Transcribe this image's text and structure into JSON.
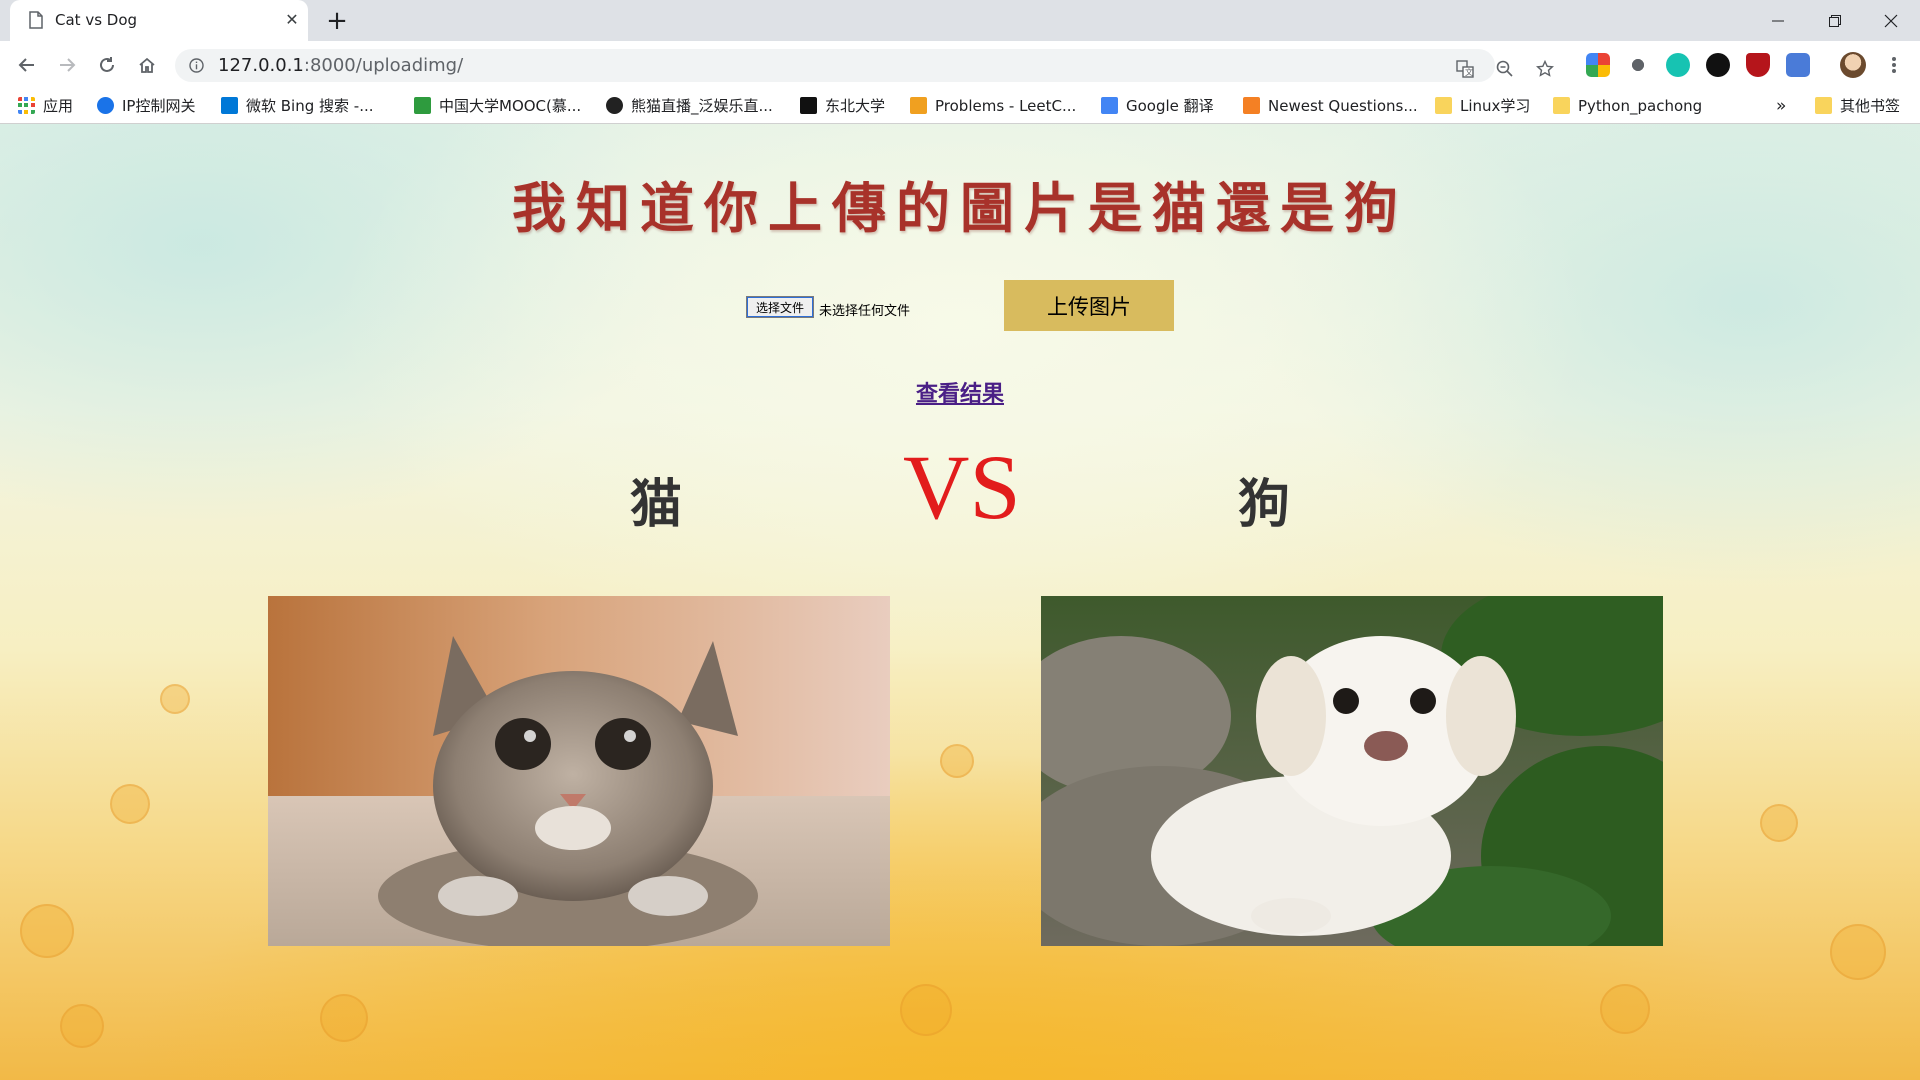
{
  "browser": {
    "tab_title": "Cat vs Dog",
    "url_host": "127.0.0.1",
    "url_path": ":8000/uploadimg/",
    "icons": [
      "doc-icon",
      "close-icon",
      "plus-icon",
      "back-icon",
      "forward-icon",
      "reload-icon",
      "home-icon",
      "info-icon",
      "translate-icon",
      "zoom-icon",
      "star-icon",
      "menu-icon"
    ]
  },
  "bookmarks": [
    {
      "label": "应用",
      "color": "#ea4335"
    },
    {
      "label": "IP控制网关",
      "color": "#1a73e8"
    },
    {
      "label": "微软 Bing 搜索 -...",
      "color": "#0078d7"
    },
    {
      "label": "中国大学MOOC(慕...",
      "color": "#2e9b3e"
    },
    {
      "label": "熊猫直播_泛娱乐直...",
      "color": "#222222"
    },
    {
      "label": "东北大学",
      "color": "#111111"
    },
    {
      "label": "Problems - LeetC...",
      "color": "#f0a020"
    },
    {
      "label": "Google 翻译",
      "color": "#4285f4"
    },
    {
      "label": "Newest Questions...",
      "color": "#f48024"
    },
    {
      "label": "Linux学习",
      "color": "#f9d45c"
    },
    {
      "label": "Python_pachong",
      "color": "#f9d45c"
    },
    {
      "label": "其他书签",
      "color": "#f9d45c"
    }
  ],
  "bookmarks_overflow": "»",
  "page": {
    "headline": "我知道你上傳的圖片是猫還是狗",
    "file_button": "选择文件",
    "file_status": "未选择任何文件",
    "upload_button": "上传图片",
    "result_link": "查看结果",
    "cat_label": "猫",
    "vs": "VS",
    "dog_label": "狗",
    "colors": {
      "headline": "#a8322a",
      "vs": "#e21c1c",
      "upload_bg": "#d8bb5e",
      "link": "#4a1f86"
    }
  }
}
